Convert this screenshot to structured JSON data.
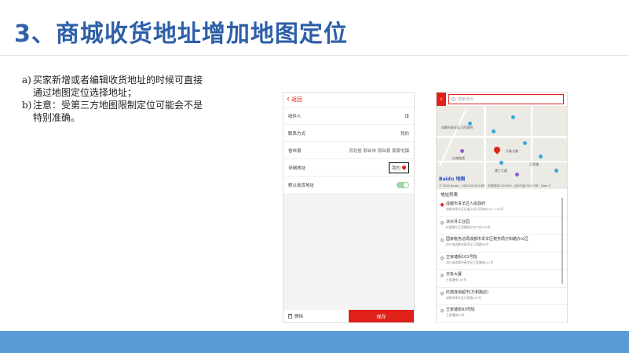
{
  "slide": {
    "title": "3、商城收货地址增加地图定位",
    "notes": [
      {
        "mark": "a)",
        "text": "买家新增或者编辑收货地址的时候可直接通过地图定位选择地址；"
      },
      {
        "mark": "b)",
        "text": "注意：受第三方地图限制定位可能会不是特别准确。"
      }
    ]
  },
  "form_screen": {
    "back_label": "返回",
    "rows": [
      {
        "label": "收件人",
        "value": "谋"
      },
      {
        "label": "联系方式",
        "value": "我的"
      },
      {
        "label": "省市县",
        "value": "河北省 邢台市 邢台县 豪家屯镇"
      }
    ],
    "address_label": "详细地址",
    "address_value": "我的",
    "default_label": "默认收货地址",
    "delete_label": "删除",
    "save_label": "保存"
  },
  "map_screen": {
    "search_placeholder": "搜索地点",
    "map_labels": {
      "l1": "成都市青羊区人民政府",
      "l2": "天象大厦",
      "l3": "建工大厦",
      "l4": "王家塘",
      "l5": "红旗连锁"
    },
    "baidu_logo": "Baidu 地图",
    "copyright": "© 2020 Baidu - GS(2019)5218号 - 甲测资字1100930 - 京ICP证030173号 - Data ©",
    "list_title": "地址列表",
    "poi_list": [
      {
        "name": "成都市青羊区人民政府",
        "addr": "成都市青羊区长顺上街2号政府224~229号"
      },
      {
        "name": "凉水井工业园",
        "addr": "红星路与王家塘街交叉口东100米"
      },
      {
        "name": "国家税务总局成都市青羊区税务局万和路办公区",
        "addr": "四川省成都市青羊区万和路99号"
      },
      {
        "name": "王家塘街101号院",
        "addr": "四川省成都市青羊区王家塘街101号"
      },
      {
        "name": "天象大厦",
        "addr": "王家塘街105号"
      },
      {
        "name": "红旗连锁超市(万和路店)",
        "addr": "成都市青羊区万和路103号"
      },
      {
        "name": "王家塘街93号院",
        "addr": "王家塘街93号"
      }
    ]
  },
  "colors": {
    "title": "#2e5fa8",
    "accent_red": "#e0211a",
    "bottom_band": "#5b9bd5"
  }
}
